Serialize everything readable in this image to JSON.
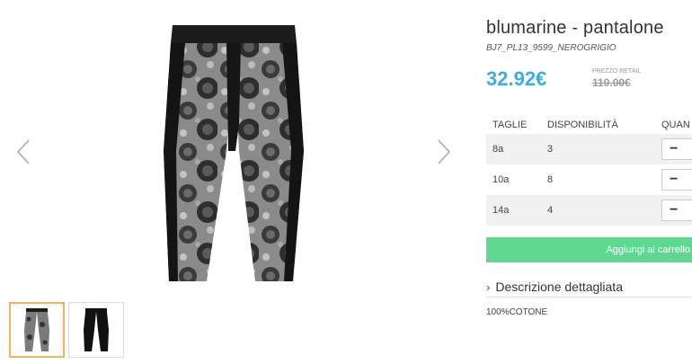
{
  "product": {
    "title": "blumarine - pantalone",
    "sku": "BJ7_PL13_9599_NEROGRIGIO",
    "price": "32.92€",
    "retail_label": "PREZZO RETAIL",
    "retail_price": "110.00€"
  },
  "sizes_table": {
    "headers": [
      "TAGLIE",
      "DISPONIBILITÀ",
      "QUAN"
    ],
    "rows": [
      {
        "size": "8a",
        "availability": "3",
        "qty": "−"
      },
      {
        "size": "10a",
        "availability": "8",
        "qty": "−"
      },
      {
        "size": "14a",
        "availability": "4",
        "qty": "−"
      }
    ]
  },
  "cart_button": "Aggiungi al carrello",
  "description": {
    "label": "Descrizione dettagliata",
    "composition": "100%COTONE"
  },
  "gallery": {
    "prev_icon": "chevron-left-icon",
    "next_icon": "chevron-right-icon",
    "selected_thumbnail": 1
  },
  "colors": {
    "price": "#3aaee4",
    "cart_button": "#5ed890",
    "thumb_active_border": "#f0b35a"
  }
}
